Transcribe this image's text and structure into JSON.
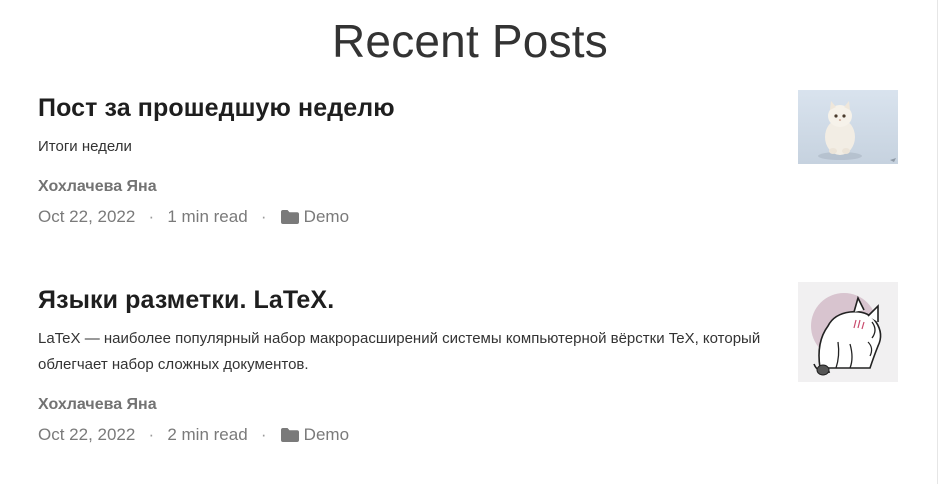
{
  "section": {
    "title": "Recent Posts"
  },
  "posts": [
    {
      "title": "Пост за прошедшую неделю",
      "summary": "Итоги недели",
      "author": "Хохлачева Яна",
      "date": "Oct 22, 2022",
      "separator": "·",
      "read_time": "1 min read",
      "category": "Demo",
      "category_icon": "folder-icon",
      "thumbnail": "white-kitten-photo"
    },
    {
      "title": "Языки разметки. LaTeX.",
      "summary": "LaTeX — наиболее популярный набор макрорасширений системы компьютерной вёрстки TeX, который облегчает набор сложных документов.",
      "author": "Хохлачева Яна",
      "date": "Oct 22, 2022",
      "separator": "·",
      "read_time": "2 min read",
      "category": "Demo",
      "category_icon": "folder-icon",
      "thumbnail": "cat-illustration"
    }
  ]
}
